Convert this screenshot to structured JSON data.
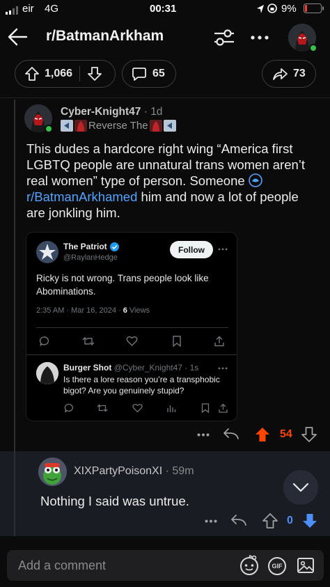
{
  "status_bar": {
    "carrier": "eir",
    "network": "4G",
    "time": "00:31",
    "battery": "9%"
  },
  "header": {
    "title": "r/BatmanArkham"
  },
  "post_actions": {
    "upvotes": "1,066",
    "comments": "65",
    "shares": "73"
  },
  "comment": {
    "author": "Cyber-Knight47",
    "age": "1d",
    "flair": "Reverse The",
    "body_before_link": "This dudes a hardcore right wing “America first LGBTQ people are unnatural trans women aren’t real women” type of person. Someone ",
    "link": "r/BatmanArkhamed",
    "body_after_link": " him and now a lot of people are jonkling him.",
    "score": "54"
  },
  "tweet": {
    "name": "The Patriot",
    "handle": "@RaylanHedge",
    "follow_label": "Follow",
    "text": "Ricky is not wrong. Trans people look like Abominations.",
    "meta": "2:35 AM · Mar 16, 2024 · ",
    "views_count": "6",
    "views_label": " Views",
    "reply": {
      "name": "Burger Shot",
      "handle_time": "@Cyber_Knight47 · 1s",
      "text": "Is there a lore reason you’re a transphobic bigot? Are you genuinely stupid?"
    }
  },
  "reply": {
    "author": "XIXPartyPoisonXI",
    "age": "59m",
    "text": "Nothing I said was untrue.",
    "score": "0"
  },
  "composer": {
    "placeholder": "Add a comment",
    "gif_label": "GIF"
  },
  "colors": {
    "upvote_orange": "#ff4500",
    "downvote_blue": "#4e8ef7",
    "link_blue": "#4fa4ff",
    "online_green": "#36c24b"
  }
}
